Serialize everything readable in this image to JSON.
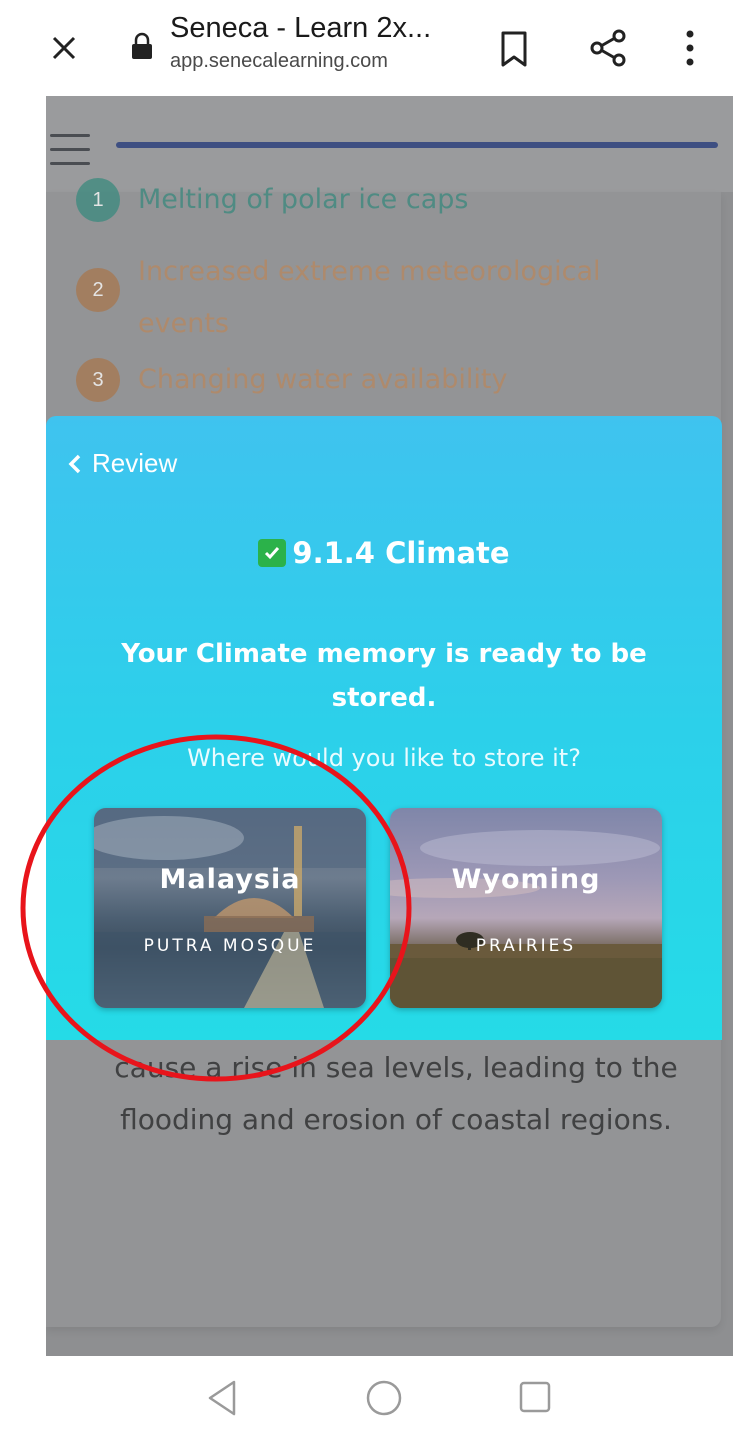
{
  "browser": {
    "page_title": "Seneca - Learn 2x...",
    "url": "app.senecalearning.com"
  },
  "background_list": [
    {
      "number": "1",
      "text": "Melting of polar ice caps",
      "color": "teal"
    },
    {
      "number": "2",
      "text": "Increased extreme meteorological events",
      "color": "orange"
    },
    {
      "number": "3",
      "text": "Changing water availability",
      "color": "orange"
    }
  ],
  "background_paragraph": "cause a rise in sea levels, leading to the flooding and erosion of coastal regions.",
  "modal": {
    "back_label": "Review",
    "topic": "9.1.4 Climate",
    "message": "Your Climate memory is ready to be stored.",
    "question": "Where would you like to store it?",
    "options": [
      {
        "name": "Malaysia",
        "subtitle": "PUTRA MOSQUE"
      },
      {
        "name": "Wyoming",
        "subtitle": "PRAIRIES"
      }
    ]
  },
  "colors": {
    "modal_top": "#3fc3ef",
    "modal_bottom": "#25dbe7",
    "annotation_circle": "#e8141b",
    "check_green": "#2bb24a"
  }
}
